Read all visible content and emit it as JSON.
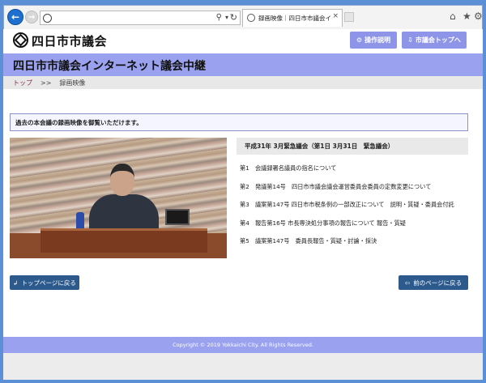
{
  "browser": {
    "tab_title": "録画映像｜四日市市議会イ...",
    "tab_close_glyph": "×",
    "back_glyph": "←",
    "forward_glyph": "→",
    "search_glyph": "⚲",
    "dropdown_glyph": "▾",
    "refresh_glyph": "↻",
    "home_glyph": "⌂",
    "favorites_glyph": "★",
    "settings_glyph": "⚙"
  },
  "header": {
    "site_name": "四日市市議会",
    "help_button": "操作説明",
    "council_top_button": "市議会トップへ",
    "help_icon_glyph": "⚙",
    "council_icon_glyph": "⇩"
  },
  "title_band": {
    "heading": "四日市市議会インターネット議会中継"
  },
  "breadcrumb": {
    "top": "トップ",
    "separator": ">>",
    "current": "録画映像"
  },
  "main": {
    "notice": "過去の本会議の録画映像を御覧いただけます。",
    "session_title": "平成31年 3月緊急議会（第1日 3月31日　緊急議会）",
    "agenda": [
      "第1　会議録署名議員の指名について",
      "第2　発議第14号　四日市市議会議会運営委員会委員の定数変更について",
      "第3　議案第147号 四日市市税条例の一部改正について　説明・質疑・委員会付託",
      "第4　報告第16号 市長専決処分事項の報告について 報告・質疑",
      "第5　議案第147号　委員長報告・質疑・討論・採決"
    ],
    "to_top_button": "トップページに戻る",
    "to_prev_button": "前のページに戻る",
    "to_top_icon_glyph": "↲",
    "to_prev_icon_glyph": "⇦"
  },
  "footer": {
    "copyright": "Copyright © 2019 Yokkaichi City. All Rights Reserved."
  },
  "colors": {
    "accent": "#9aa2ef",
    "button_dark": "#2c5a8c",
    "header_button": "#8e95e8"
  }
}
